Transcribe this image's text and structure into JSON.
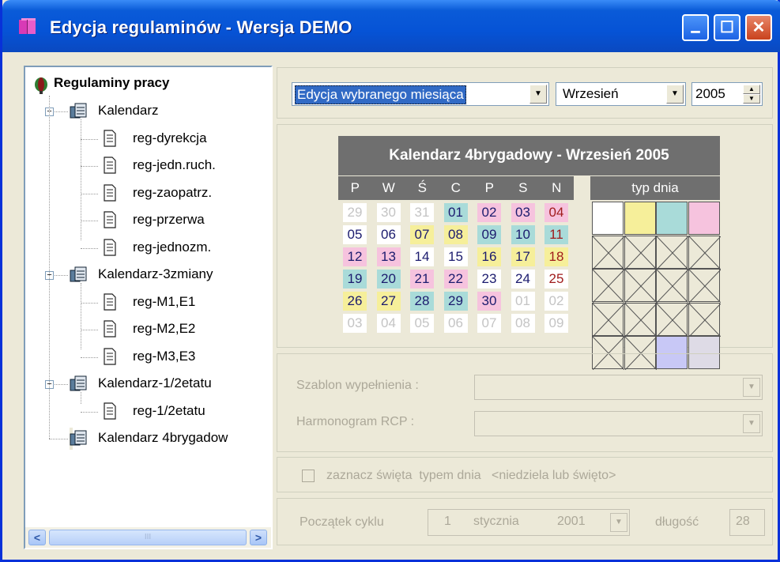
{
  "window": {
    "title": "Edycja regulaminów - Wersja DEMO",
    "min_glyph": "▁",
    "max_glyph": "☐",
    "close_glyph": "✕"
  },
  "tree": {
    "root_label": "Regulaminy pracy",
    "nodes": [
      {
        "label": "Kalendarz",
        "level": 1,
        "expander": "−"
      },
      {
        "label": "reg-dyrekcja",
        "level": 2
      },
      {
        "label": "reg-jedn.ruch.",
        "level": 2
      },
      {
        "label": "reg-zaopatrz.",
        "level": 2
      },
      {
        "label": "reg-przerwa",
        "level": 2
      },
      {
        "label": "reg-jednozm.",
        "level": 2
      },
      {
        "label": "Kalendarz-3zmiany",
        "level": 1,
        "expander": "−"
      },
      {
        "label": "reg-M1,E1",
        "level": 2
      },
      {
        "label": "reg-M2,E2",
        "level": 2
      },
      {
        "label": "reg-M3,E3",
        "level": 2
      },
      {
        "label": "Kalendarz-1/2etatu",
        "level": 1,
        "expander": "−"
      },
      {
        "label": "reg-1/2etatu",
        "level": 2
      },
      {
        "label": "Kalendarz 4brygadow",
        "level": 1,
        "selected": true
      }
    ],
    "scroll_left": "<",
    "scroll_right": ">",
    "scroll_thumb": "III"
  },
  "toolbar": {
    "mode_value": "Edycja wybranego miesiąca",
    "month_value": "Wrzesień",
    "year_value": "2005"
  },
  "calendar": {
    "title": "Kalendarz 4brygadowy - Wrzesień 2005",
    "weekdays": [
      "P",
      "W",
      "Ś",
      "C",
      "P",
      "S",
      "N"
    ],
    "typ_label": "typ dnia",
    "weeks": [
      [
        {
          "d": "29",
          "c": "out"
        },
        {
          "d": "30",
          "c": "out"
        },
        {
          "d": "31",
          "c": "out"
        },
        {
          "d": "01",
          "c": "blue"
        },
        {
          "d": "02",
          "c": "pink"
        },
        {
          "d": "03",
          "c": "pink"
        },
        {
          "d": "04",
          "c": "pink"
        }
      ],
      [
        {
          "d": "05",
          "c": "white"
        },
        {
          "d": "06",
          "c": "white"
        },
        {
          "d": "07",
          "c": "yellow"
        },
        {
          "d": "08",
          "c": "yellow"
        },
        {
          "d": "09",
          "c": "blue"
        },
        {
          "d": "10",
          "c": "blue"
        },
        {
          "d": "11",
          "c": "blue"
        }
      ],
      [
        {
          "d": "12",
          "c": "pink"
        },
        {
          "d": "13",
          "c": "pink"
        },
        {
          "d": "14",
          "c": "white"
        },
        {
          "d": "15",
          "c": "white"
        },
        {
          "d": "16",
          "c": "yellow"
        },
        {
          "d": "17",
          "c": "yellow"
        },
        {
          "d": "18",
          "c": "yellow"
        }
      ],
      [
        {
          "d": "19",
          "c": "blue"
        },
        {
          "d": "20",
          "c": "blue"
        },
        {
          "d": "21",
          "c": "pink"
        },
        {
          "d": "22",
          "c": "pink"
        },
        {
          "d": "23",
          "c": "white"
        },
        {
          "d": "24",
          "c": "white"
        },
        {
          "d": "25",
          "c": "white"
        }
      ],
      [
        {
          "d": "26",
          "c": "yellow"
        },
        {
          "d": "27",
          "c": "yellow"
        },
        {
          "d": "28",
          "c": "blue"
        },
        {
          "d": "29",
          "c": "blue"
        },
        {
          "d": "30",
          "c": "pink"
        },
        {
          "d": "01",
          "c": "out"
        },
        {
          "d": "02",
          "c": "out"
        }
      ],
      [
        {
          "d": "03",
          "c": "out"
        },
        {
          "d": "04",
          "c": "out"
        },
        {
          "d": "05",
          "c": "out"
        },
        {
          "d": "06",
          "c": "out"
        },
        {
          "d": "07",
          "c": "out"
        },
        {
          "d": "08",
          "c": "out"
        },
        {
          "d": "09",
          "c": "out"
        }
      ]
    ],
    "typ_colors": [
      [
        "#ffffff",
        "#f6ef9a",
        "#a9dbd9",
        "#f6c3de"
      ],
      [
        "x",
        "x",
        "x",
        "x"
      ],
      [
        "x",
        "x",
        "x",
        "x"
      ],
      [
        "x",
        "x",
        "x",
        "x"
      ],
      [
        "x",
        "x",
        "#c8c8f6",
        "#dedbe6"
      ]
    ],
    "colors": {
      "white": "#ffffff",
      "yellow": "#f6ef9a",
      "blue": "#a9dbd9",
      "pink": "#f6c3de",
      "out": "#ffffff"
    }
  },
  "form": {
    "szablon_label": "Szablon wypełnienia :",
    "harmonogram_label": "Harmonogram RCP :",
    "checkbox_label": "zaznacz święta  typem dnia   <niedziela lub święto>",
    "cycle_label": "Początek cyklu",
    "cycle_day": "1",
    "cycle_month": "stycznia",
    "cycle_year": "2001",
    "length_label": "długość",
    "length_value": "28"
  }
}
